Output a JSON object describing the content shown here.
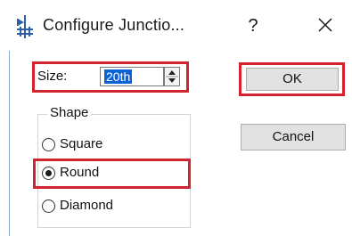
{
  "window": {
    "title": "Configure Junctio...",
    "help_label": "?",
    "icons": {
      "app": "junction-icon",
      "close": "close-icon"
    }
  },
  "size": {
    "label": "Size:",
    "value": "20th"
  },
  "shape": {
    "group_label": "Shape",
    "options": [
      {
        "label": "Square",
        "selected": false
      },
      {
        "label": "Round",
        "selected": true
      },
      {
        "label": "Diamond",
        "selected": false
      }
    ]
  },
  "buttons": {
    "ok_label": "OK",
    "cancel_label": "Cancel"
  },
  "colors": {
    "highlight": "#d3232f",
    "selection": "#0a63d6",
    "button_face": "#e1e1e1"
  }
}
